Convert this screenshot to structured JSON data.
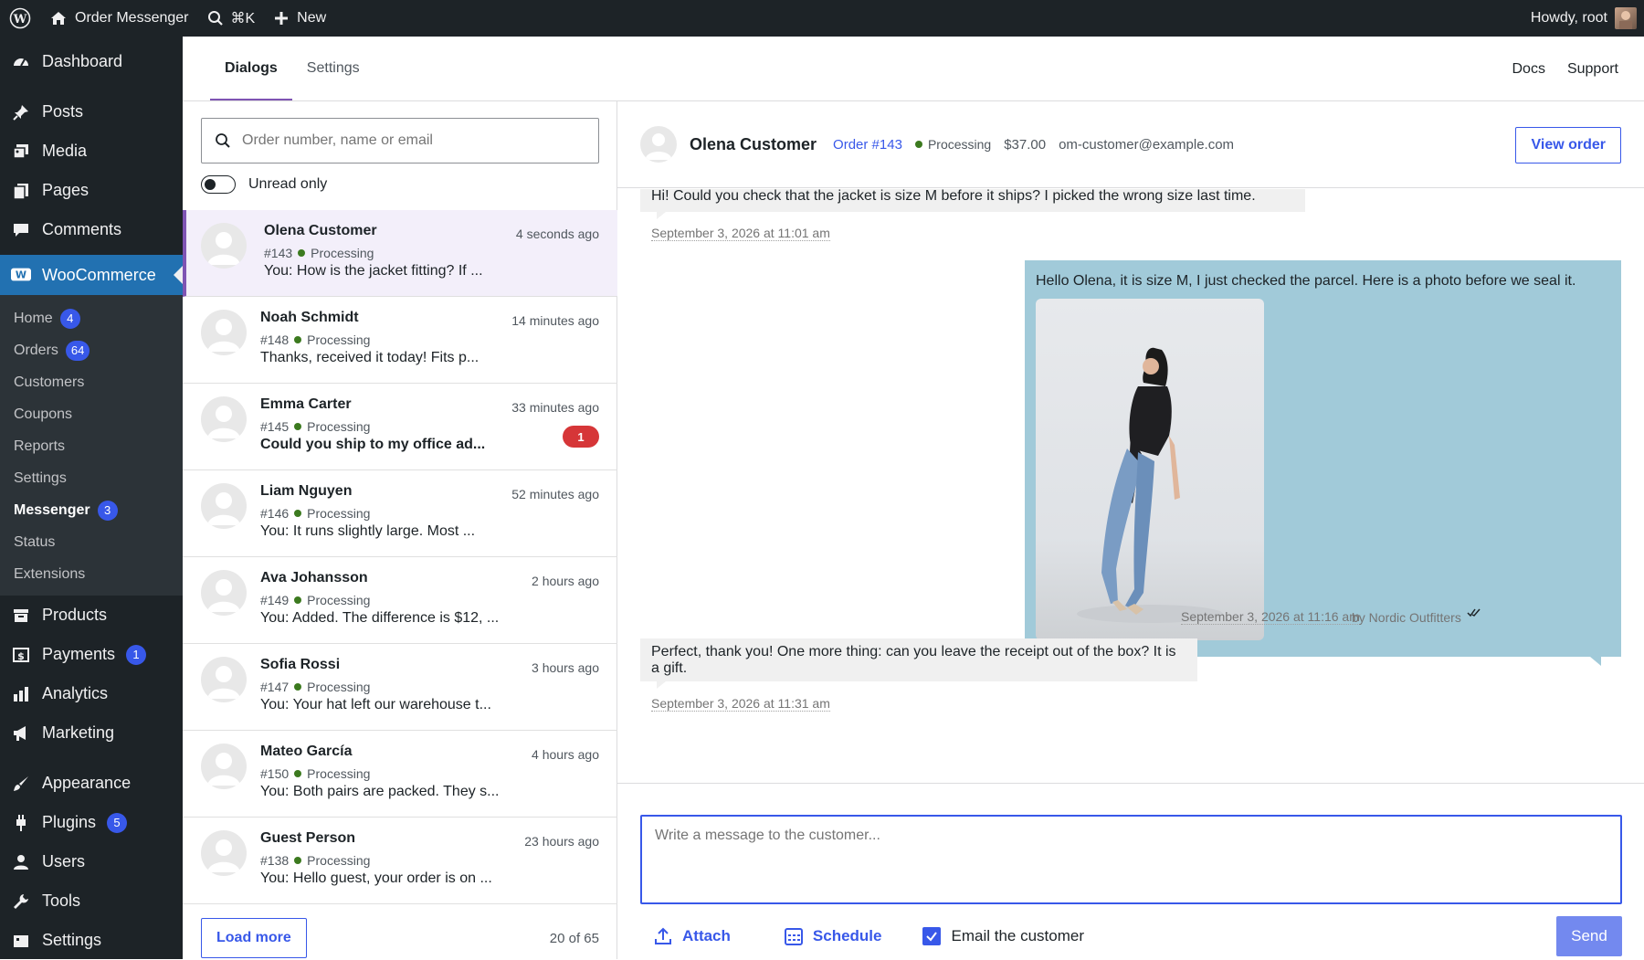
{
  "adminbar": {
    "site_name": "Order Messenger",
    "search_shortcut": "⌘K",
    "new_label": "New",
    "howdy": "Howdy, root"
  },
  "sidebar": {
    "top": [
      {
        "label": "Dashboard",
        "icon": "dashboard-icon"
      },
      {
        "label": "Posts",
        "icon": "pin-icon"
      },
      {
        "label": "Media",
        "icon": "media-icon"
      },
      {
        "label": "Pages",
        "icon": "pages-icon"
      },
      {
        "label": "Comments",
        "icon": "comment-icon"
      }
    ],
    "woocommerce": "WooCommerce",
    "woo_sub": [
      {
        "label": "Home",
        "count": "4"
      },
      {
        "label": "Orders",
        "count": "64"
      },
      {
        "label": "Customers",
        "count": ""
      },
      {
        "label": "Coupons",
        "count": ""
      },
      {
        "label": "Reports",
        "count": ""
      },
      {
        "label": "Settings",
        "count": ""
      },
      {
        "label": "Messenger",
        "count": "3"
      },
      {
        "label": "Status",
        "count": ""
      },
      {
        "label": "Extensions",
        "count": ""
      }
    ],
    "bottom": [
      {
        "label": "Products",
        "count": ""
      },
      {
        "label": "Payments",
        "count": "1"
      },
      {
        "label": "Analytics",
        "count": ""
      },
      {
        "label": "Marketing",
        "count": ""
      },
      {
        "label": "Appearance",
        "count": ""
      },
      {
        "label": "Plugins",
        "count": "5"
      },
      {
        "label": "Users",
        "count": ""
      },
      {
        "label": "Tools",
        "count": ""
      },
      {
        "label": "Settings",
        "count": ""
      }
    ]
  },
  "topnav": {
    "tabs": [
      "Dialogs",
      "Settings"
    ],
    "links": [
      "Docs",
      "Support"
    ]
  },
  "list": {
    "search_placeholder": "Order number, name or email",
    "unread_label": "Unread only",
    "dialogs": [
      {
        "name": "Olena Customer",
        "order": "#143",
        "status": "Processing",
        "time": "4 seconds ago",
        "preview": "You: How is the jacket fitting? If ...",
        "unread": ""
      },
      {
        "name": "Noah Schmidt",
        "order": "#148",
        "status": "Processing",
        "time": "14 minutes ago",
        "preview": "Thanks, received it today! Fits p...",
        "unread": ""
      },
      {
        "name": "Emma Carter",
        "order": "#145",
        "status": "Processing",
        "time": "33 minutes ago",
        "preview": "Could you ship to my office ad...",
        "unread": "1"
      },
      {
        "name": "Liam Nguyen",
        "order": "#146",
        "status": "Processing",
        "time": "52 minutes ago",
        "preview": "You: It runs slightly large. Most ...",
        "unread": ""
      },
      {
        "name": "Ava Johansson",
        "order": "#149",
        "status": "Processing",
        "time": "2 hours ago",
        "preview": "You: Added. The difference is $12, ...",
        "unread": ""
      },
      {
        "name": "Sofia Rossi",
        "order": "#147",
        "status": "Processing",
        "time": "3 hours ago",
        "preview": "You: Your hat left our warehouse t...",
        "unread": ""
      },
      {
        "name": "Mateo García",
        "order": "#150",
        "status": "Processing",
        "time": "4 hours ago",
        "preview": "You: Both pairs are packed. They s...",
        "unread": ""
      },
      {
        "name": "Guest Person",
        "order": "#138",
        "status": "Processing",
        "time": "23 hours ago",
        "preview": "You: Hello guest, your order is on ...",
        "unread": ""
      }
    ],
    "load_more": "Load more",
    "count": "20 of 65"
  },
  "chat": {
    "customer": "Olena Customer",
    "order_link": "Order #143",
    "status": "Processing",
    "price": "$37.00",
    "email": "om-customer@example.com",
    "view_order": "View order",
    "messages": {
      "m1_text": "Hi! Could you check that the jacket is size M before it ships? I picked the wrong size last time.",
      "m1_time": "September 3, 2026 at 11:01 am",
      "m2_text": "Hello Olena, it is size M, I just checked the parcel. Here is a photo before we seal it.",
      "m2_time": "September 3, 2026 at 11:16 am",
      "m2_by": "by Nordic Outfitters",
      "m3_text": "Perfect, thank you! One more thing: can you leave the receipt out of the box? It is a gift.",
      "m3_time": "September 3, 2026 at 11:31 am"
    },
    "composer_placeholder": "Write a message to the customer...",
    "attach": "Attach",
    "schedule": "Schedule",
    "email_customer": "Email the customer",
    "send": "Send"
  },
  "colors": {
    "accent": "#3858e9",
    "woo_purple": "#7f54b3",
    "admin_dark": "#1d2327",
    "outgoing_bubble": "#a1cad9",
    "unread_badge": "#d63638"
  }
}
